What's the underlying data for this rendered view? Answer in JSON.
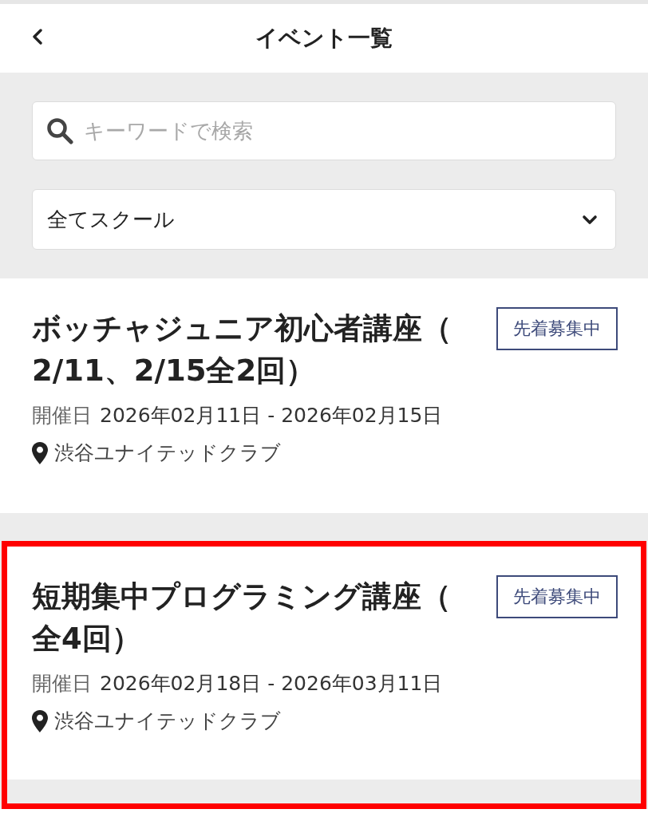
{
  "header": {
    "title": "イベント一覧"
  },
  "search": {
    "placeholder": "キーワードで検索"
  },
  "school_select": {
    "value": "全てスクール"
  },
  "events": [
    {
      "title": "ボッチャジュニア初心者講座（2/11、2/15全2回）",
      "badge": "先着募集中",
      "date_label": "開催日",
      "dates": "2026年02月11日 - 2026年02月15日",
      "location": "渋谷ユナイテッドクラブ",
      "highlighted": false
    },
    {
      "title": "短期集中プログラミング講座（全4回）",
      "badge": "先着募集中",
      "date_label": "開催日",
      "dates": "2026年02月18日 - 2026年03月11日",
      "location": "渋谷ユナイテッドクラブ",
      "highlighted": true
    }
  ]
}
